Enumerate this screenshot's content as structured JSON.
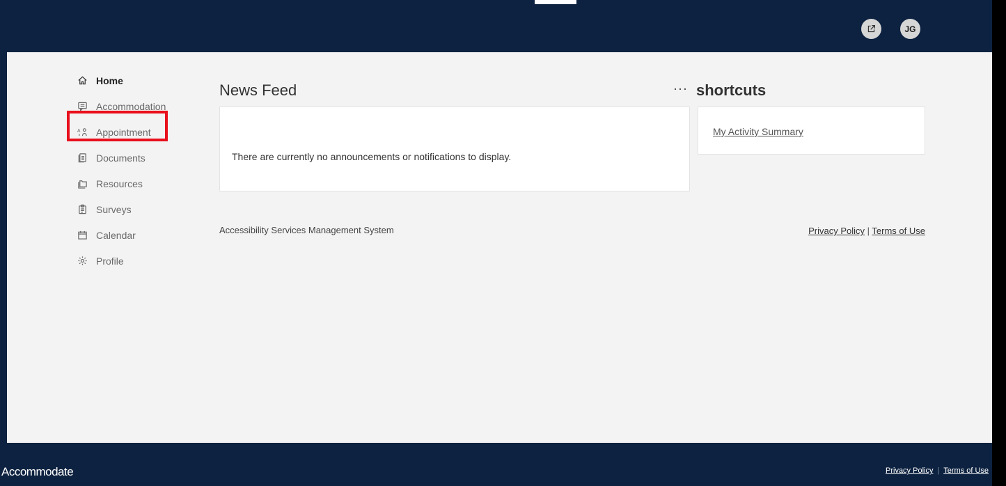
{
  "header": {
    "external_icon": "external-link-icon",
    "avatar_initials": "JG"
  },
  "sidebar": {
    "items": [
      {
        "label": "Home",
        "icon": "home-icon",
        "active": true
      },
      {
        "label": "Accommodation",
        "icon": "chat-icon"
      },
      {
        "label": "Appointment",
        "icon": "people-icon",
        "highlighted": true
      },
      {
        "label": "Documents",
        "icon": "documents-icon"
      },
      {
        "label": "Resources",
        "icon": "folder-icon"
      },
      {
        "label": "Surveys",
        "icon": "clipboard-icon"
      },
      {
        "label": "Calendar",
        "icon": "calendar-icon"
      },
      {
        "label": "Profile",
        "icon": "gear-icon"
      }
    ]
  },
  "news_feed": {
    "title": "News Feed",
    "empty_message": "There are currently no announcements or notifications to display.",
    "more_label": "···"
  },
  "shortcuts": {
    "title": "shortcuts",
    "links": [
      "My Activity Summary"
    ]
  },
  "content_footer": {
    "system_name": "Accessibility Services Management System",
    "privacy": "Privacy Policy",
    "separator": "|",
    "terms": "Terms of Use"
  },
  "page_footer": {
    "brand": "Accommodate",
    "privacy": "Privacy Policy",
    "separator": "|",
    "terms": "Terms of Use"
  },
  "colors": {
    "header_bg": "#0d2240",
    "content_bg": "#f3f3f3",
    "highlight": "#e8101c"
  }
}
